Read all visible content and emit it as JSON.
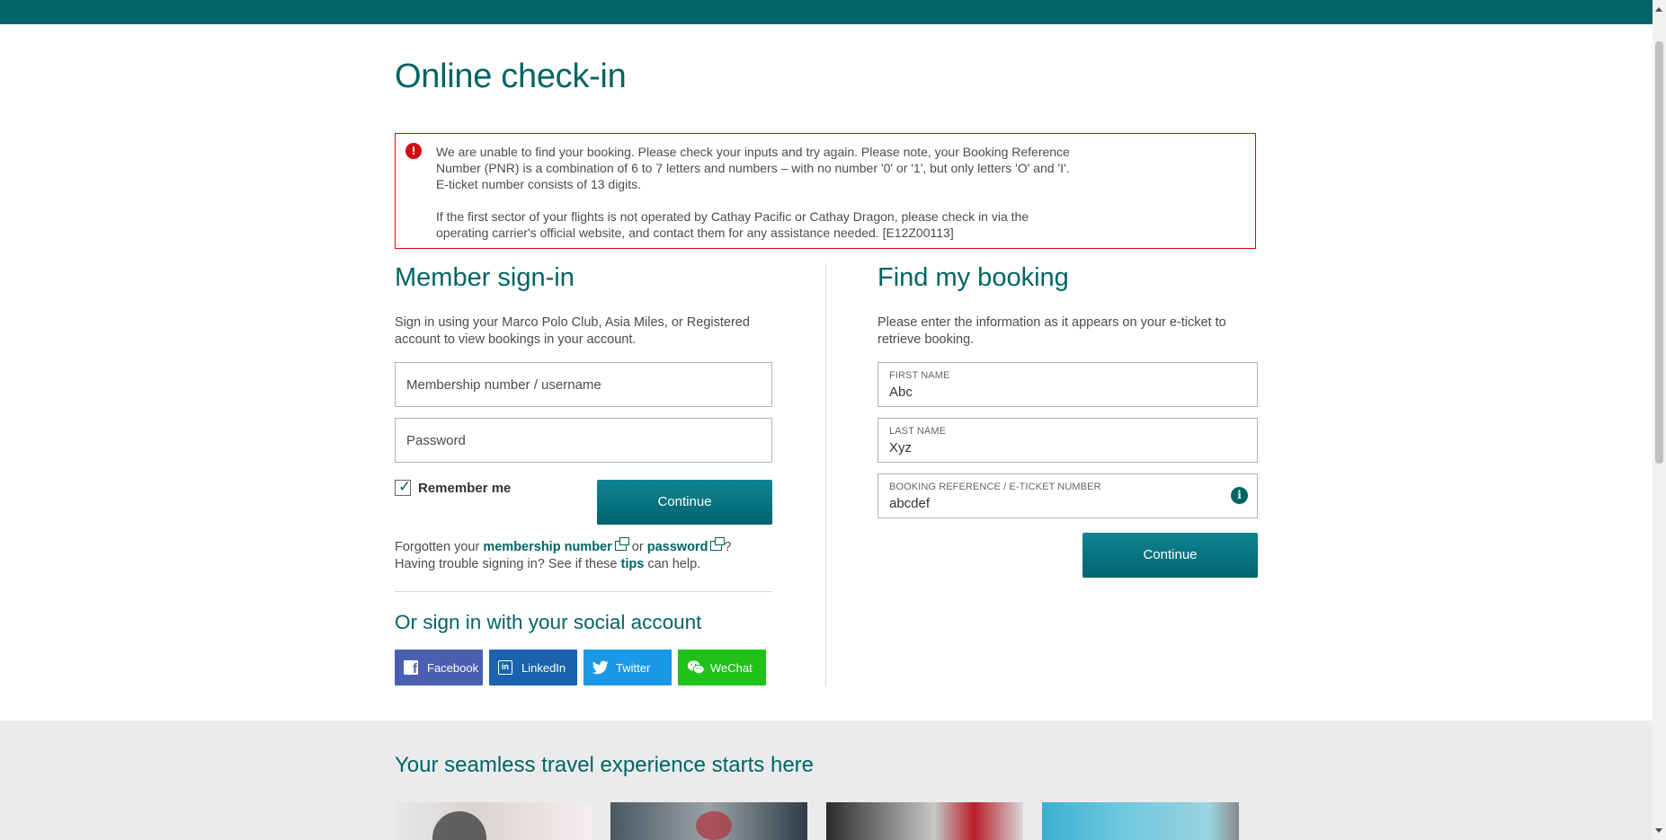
{
  "page_title": "Online check-in",
  "error": {
    "paragraph1": "We are unable to find your booking. Please check your inputs and try again. Please note, your Booking Reference Number (PNR) is a combination of 6 to 7 letters and numbers – with no number '0' or '1', but only letters 'O' and 'I'. E-ticket number consists of 13 digits.",
    "paragraph2": "If the first sector of your flights is not operated by Cathay Pacific or Cathay Dragon, please check in via the operating carrier's official website, and contact them for any assistance needed. [E12Z00113]"
  },
  "member": {
    "heading": "Member sign-in",
    "description": "Sign in using your Marco Polo Club, Asia Miles, or Registered account to view bookings in your account.",
    "username_placeholder": "Membership number / username",
    "password_placeholder": "Password",
    "remember_label": "Remember me",
    "remember_checked": true,
    "continue_label": "Continue",
    "help_forgotten": "Forgotten your",
    "help_membership_link": "membership number",
    "help_or": "or",
    "help_password_link": "password",
    "help_q": "?",
    "help_trouble": "Having trouble signing in? See if these",
    "help_tips_link": "tips",
    "help_can_help": "can help."
  },
  "social": {
    "heading": "Or sign in with your social account",
    "buttons": [
      {
        "label": "Facebook",
        "icon": "facebook-icon",
        "color": "#4b5fb0"
      },
      {
        "label": "LinkedIn",
        "icon": "linkedin-icon",
        "color": "#1a63b0"
      },
      {
        "label": "Twitter",
        "icon": "twitter-icon",
        "color": "#1a99e6"
      },
      {
        "label": "WeChat",
        "icon": "wechat-icon",
        "color": "#1fc219"
      }
    ]
  },
  "booking": {
    "heading": "Find my booking",
    "description": "Please enter the information as it appears on your e-ticket to retrieve booking.",
    "first_name_label": "FIRST NAME",
    "first_name_value": "Abc",
    "last_name_label": "LAST NAME",
    "last_name_value": "Xyz",
    "ref_label": "BOOKING REFERENCE / E-TICKET NUMBER",
    "ref_value": "abcdef",
    "info_icon": "i",
    "continue_label": "Continue"
  },
  "promo": {
    "heading": "Your seamless travel experience starts here"
  },
  "colors": {
    "brand": "#006564",
    "error": "#d30a10",
    "button": "#00646f"
  }
}
